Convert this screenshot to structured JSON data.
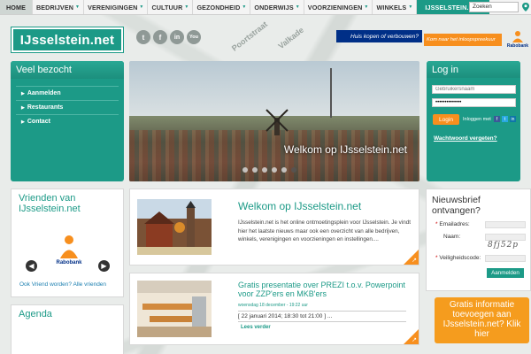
{
  "nav": {
    "items": [
      {
        "label": "HOME",
        "arrow": false
      },
      {
        "label": "BEDRIJVEN",
        "arrow": true
      },
      {
        "label": "VERENIGINGEN",
        "arrow": true
      },
      {
        "label": "CULTUUR",
        "arrow": true
      },
      {
        "label": "GEZONDHEID",
        "arrow": true
      },
      {
        "label": "ONDERWIJS",
        "arrow": true
      },
      {
        "label": "VOORZIENINGEN",
        "arrow": true
      },
      {
        "label": "WINKELS",
        "arrow": true
      },
      {
        "label": "IJSSELSTEIN.NET",
        "arrow": false
      }
    ],
    "search_value": "Zoeken"
  },
  "logo": "IJsselstein.net",
  "social": [
    "t",
    "f",
    "in",
    "You"
  ],
  "map_streets": [
    "Poortstraat",
    "Valkade"
  ],
  "banner": {
    "blue_text": "Huis kopen of verbouwen?",
    "orange_text": "Kom naar het inloopspreekuur",
    "brand": "Rabobank"
  },
  "veel_bezocht": {
    "title": "Veel bezocht",
    "links": [
      "Aanmelden",
      "Restaurants",
      "Contact"
    ]
  },
  "slider": {
    "caption": "Welkom op IJsselstein.net",
    "dots": 6,
    "active_dot": 6
  },
  "login": {
    "title": "Log in",
    "username_placeholder": "Gebruikersnaam",
    "password_value": "••••••••••••••",
    "button": "Login",
    "via": "Inloggen met",
    "forgot": "Wachtwoord vergeten?"
  },
  "vrienden": {
    "title": "Vrienden van IJsselstein.net",
    "sponsor": "Rabobank",
    "footer": "Ook Vriend worden? Alle vrienden"
  },
  "agenda": {
    "title": "Agenda"
  },
  "article1": {
    "title": "Welkom op IJsselstein.net",
    "text": "IJsselstein.net is het online ontmoetingsplein voor IJsselstein. Je vindt hier het laatste nieuws maar ook een overzicht van alle bedrijven, winkels, verenigingen en voorzieningen en instellingen...."
  },
  "article2": {
    "title": "Gratis presentatie over PREZI t.o.v. Powerpoint voor ZZP'ers en MKB'ers",
    "meta": "woensdag 18 december - 19:22 uur",
    "date": "[ 22 januari 2014; 18:30 tot 21:00 ] ...",
    "read_more": "Lees verder"
  },
  "newsletter": {
    "title": "Nieuwsbrief ontvangen?",
    "email_label": "Emailadres:",
    "name_label": "Naam:",
    "captcha": "8fj52p",
    "code_label": "Veiligheidscode:",
    "button": "Aanmelden"
  },
  "promo": {
    "text": "Gratis informatie toevoegen aan IJsselstein.net? Klik hier"
  },
  "colors": {
    "accent": "#1c9a87",
    "orange": "#f78f1e",
    "rabobank_blue": "#002f87"
  }
}
